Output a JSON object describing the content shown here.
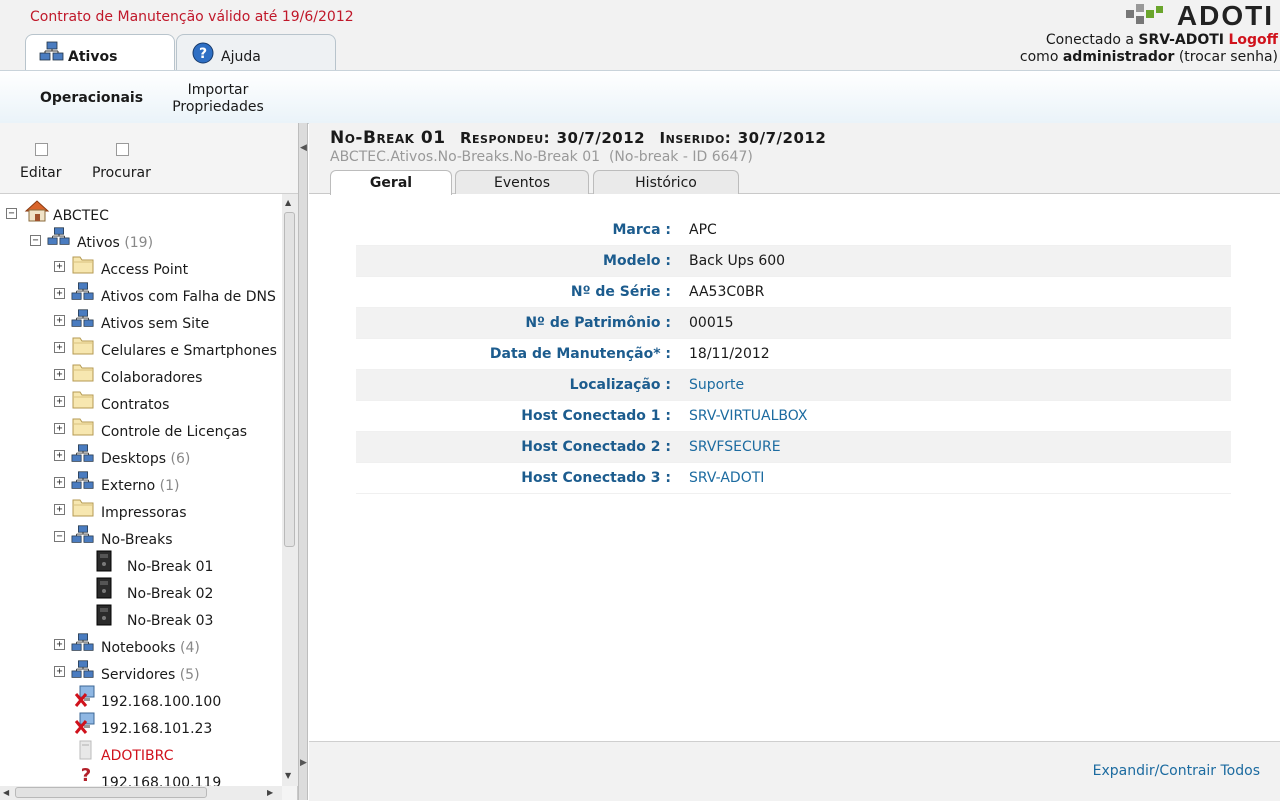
{
  "header": {
    "contract": "Contrato de Manutenção válido até 19/6/2012",
    "tabs": [
      {
        "label": "Ativos",
        "icon": "network-icon",
        "active": true
      },
      {
        "label": "Ajuda",
        "icon": "help-icon",
        "active": false
      }
    ],
    "logo": "ADOTI",
    "connected_prefix": "Conectado a",
    "server": "SRV-ADOTI",
    "logoff": "Logoff",
    "as_prefix": "como",
    "user": "administrador",
    "change_password": "(trocar senha)"
  },
  "subnav": {
    "operacionais": "Operacionais",
    "importar_line1": "Importar",
    "importar_line2": "Propriedades"
  },
  "left_tools": {
    "edit": "Editar",
    "search": "Procurar"
  },
  "tree": {
    "root": "ABCTEC",
    "ativos": {
      "label": "Ativos",
      "count": "(19)"
    },
    "items": [
      {
        "label": "Access Point",
        "icon": "folder-icon",
        "count": ""
      },
      {
        "label": "Ativos com Falha de DNS",
        "icon": "network-icon",
        "count": ""
      },
      {
        "label": "Ativos sem Site",
        "icon": "network-icon",
        "count": ""
      },
      {
        "label": "Celulares e Smartphones",
        "icon": "folder-icon",
        "count": ""
      },
      {
        "label": "Colaboradores",
        "icon": "folder-icon",
        "count": ""
      },
      {
        "label": "Contratos",
        "icon": "folder-icon",
        "count": ""
      },
      {
        "label": "Controle de Licenças",
        "icon": "folder-icon",
        "count": ""
      },
      {
        "label": "Desktops",
        "icon": "network-icon",
        "count": "(6)"
      },
      {
        "label": "Externo",
        "icon": "network-icon",
        "count": "(1)"
      },
      {
        "label": "Impressoras",
        "icon": "folder-icon",
        "count": ""
      },
      {
        "label": "No-Breaks",
        "icon": "network-icon",
        "count": ""
      }
    ],
    "nobreaks": [
      "No-Break 01",
      "No-Break 02",
      "No-Break 03"
    ],
    "after": [
      {
        "label": "Notebooks",
        "count": "(4)"
      },
      {
        "label": "Servidores",
        "count": "(5)"
      }
    ],
    "loose": [
      {
        "label": "192.168.100.100",
        "icon": "error-computer-icon"
      },
      {
        "label": "192.168.101.23",
        "icon": "error-computer-icon"
      },
      {
        "label": "ADOTIBRC",
        "icon": "computer-icon"
      },
      {
        "label": "192.168.100.119",
        "icon": "unknown-icon"
      }
    ]
  },
  "item": {
    "name": "No-Break 01",
    "responded_label": "Respondeu:",
    "responded": "30/7/2012",
    "inserted_label": "Inserido:",
    "inserted": "30/7/2012",
    "path": "ABCTEC.Ativos.No-Breaks.No-Break 01",
    "type_id": "(No-break - ID 6647)"
  },
  "item_tabs": [
    "Geral",
    "Eventos",
    "Histórico"
  ],
  "details": [
    {
      "label": "Marca :",
      "value": "APC"
    },
    {
      "label": "Modelo :",
      "value": "Back Ups 600"
    },
    {
      "label": "Nº de Série :",
      "value": "AA53C0BR"
    },
    {
      "label": "Nº de Patrimônio :",
      "value": "00015"
    },
    {
      "label": "Data de Manutenção* :",
      "value": "18/11/2012"
    },
    {
      "label": "Localização :",
      "value": "Suporte"
    },
    {
      "label": "Host Conectado 1 :",
      "value": "SRV-VIRTUALBOX"
    },
    {
      "label": "Host Conectado 2 :",
      "value": "SRVFSECURE"
    },
    {
      "label": "Host Conectado 3 :",
      "value": "SRV-ADOTI"
    }
  ],
  "footer": {
    "expand": "Expandir/Contrair Todos"
  }
}
